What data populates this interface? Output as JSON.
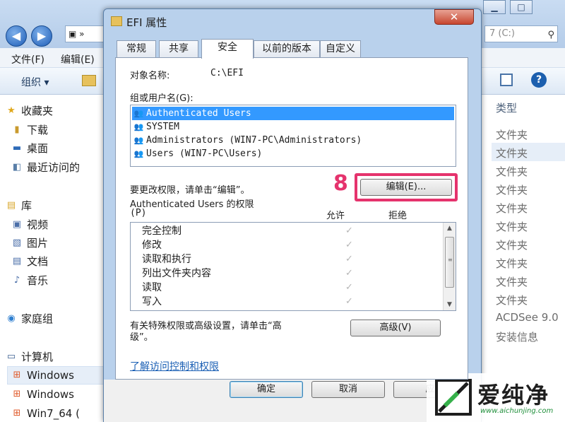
{
  "explorer": {
    "address_right": "7 (C:)",
    "menu": [
      "文件(F)",
      "编辑(E)"
    ],
    "organize": "组织 ▾",
    "nav": {
      "favorites": "收藏夹",
      "downloads": "下载",
      "desktop": "桌面",
      "recent": "最近访问的",
      "libraries": "库",
      "videos": "视频",
      "pictures": "图片",
      "documents": "文档",
      "music": "音乐",
      "homegroup": "家庭组",
      "computer": "计算机",
      "drive1": "Windows",
      "drive2": "Windows",
      "drive3": "Win7_64 ("
    },
    "type_header": "类型",
    "type_cells": [
      "文件夹",
      "文件夹",
      "文件夹",
      "文件夹",
      "文件夹",
      "文件夹",
      "文件夹",
      "文件夹",
      "文件夹",
      "文件夹",
      "ACDSee 9.0",
      "安装信息"
    ]
  },
  "dialog": {
    "title": "EFI 属性",
    "close_glyph": "✕",
    "tabs": [
      "常规",
      "共享",
      "安全",
      "以前的版本",
      "自定义"
    ],
    "object_label": "对象名称:",
    "object_value": "C:\\EFI",
    "groups_label": "组或用户名(G):",
    "users": [
      "Authenticated Users",
      "SYSTEM",
      "Administrators (WIN7-PC\\Administrators)",
      "Users (WIN7-PC\\Users)"
    ],
    "change_text": "要更改权限，请单击“编辑”。",
    "step_number": "8",
    "edit_button": "编辑(E)...",
    "perm_title": "Authenticated Users 的权限",
    "perm_title_p": "(P)",
    "allow_header": "允许",
    "deny_header": "拒绝",
    "permissions": [
      "完全控制",
      "修改",
      "读取和执行",
      "列出文件夹内容",
      "读取",
      "写入"
    ],
    "check_glyph": "✓",
    "advanced_text_1": "有关特殊权限或高级设置，请单击“高",
    "advanced_text_2": "级”。",
    "advanced_button": "高级(V)",
    "learn_link": "了解访问控制和权限",
    "ok_button": "确定",
    "cancel_button": "取消",
    "apply_button": "应"
  },
  "watermark": {
    "text": "爱纯净",
    "url": "www.aichunjing.com"
  },
  "colors": {
    "highlight": "#e5336d",
    "selection": "#3399ff",
    "link": "#1a5fb4"
  }
}
